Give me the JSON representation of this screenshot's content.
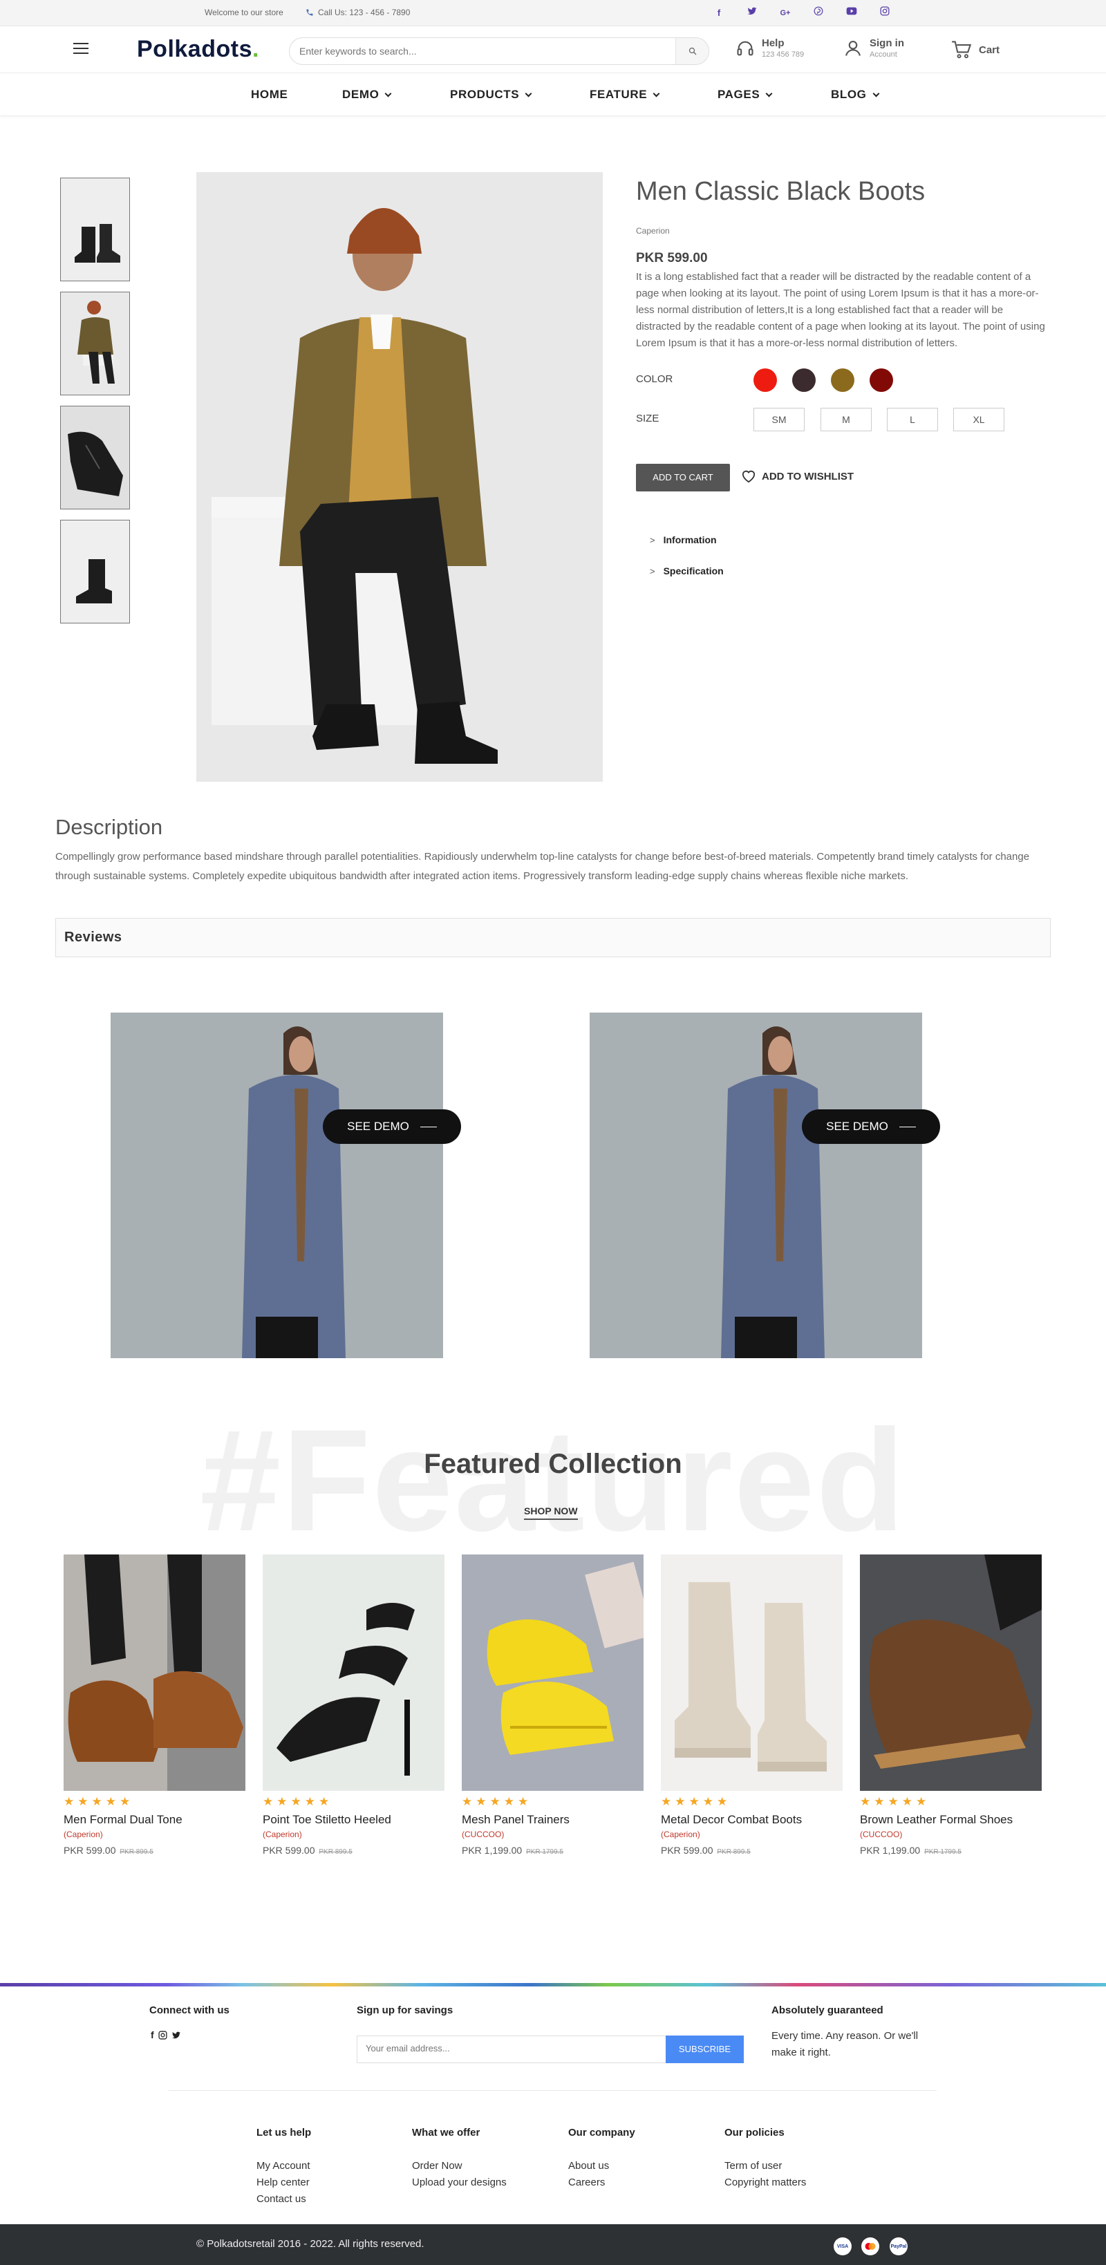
{
  "topbar": {
    "welcome": "Welcome to our store",
    "call": "Call Us: 123 - 456 - 7890",
    "socials": [
      "facebook-icon",
      "twitter-icon",
      "google-plus-icon",
      "pinterest-icon",
      "youtube-icon",
      "instagram-icon"
    ]
  },
  "header": {
    "logo": "Polkadots",
    "search_placeholder": "Enter keywords to search...",
    "help_title": "Help",
    "help_phone": "123 456 789",
    "signin_title": "Sign in",
    "signin_sub": "Account",
    "cart": "Cart"
  },
  "nav": {
    "home": "HOME",
    "demo": "DEMO",
    "products": "PRODUCTS",
    "feature": "FEATURE",
    "pages": "PAGES",
    "blog": "BLOG"
  },
  "product": {
    "title": "Men Classic Black Boots",
    "brand": "Caperion",
    "price": "PKR 599.00",
    "description": "It is a long established fact that a reader will be distracted by the readable content of a page when looking at its layout. The point of using Lorem Ipsum is that it has a more-or-less normal distribution of letters,It is a long established fact that a reader will be distracted by the readable content of a page when looking at its layout. The point of using Lorem Ipsum is that it has a more-or-less normal distribution of letters.",
    "color_label": "COLOR",
    "colors": [
      "#ee1c10",
      "#3c2b2e",
      "#8c6a1d",
      "#820a06"
    ],
    "size_label": "SIZE",
    "sizes": [
      "SM",
      "M",
      "L",
      "XL"
    ],
    "add_to_cart": "ADD TO CART",
    "add_to_wishlist": "ADD TO WISHLIST",
    "accordion": [
      "Information",
      "Specification"
    ]
  },
  "description": {
    "title": "Description",
    "text": "Compellingly grow performance based mindshare through parallel potentialities. Rapidiously underwhelm top-line catalysts for change before best-of-breed materials. Competently brand timely catalysts for change through sustainable systems. Completely expedite ubiquitous bandwidth after integrated action items. Progressively transform leading-edge supply chains whereas flexible niche markets."
  },
  "reviews": {
    "title": "Reviews"
  },
  "demo": {
    "button": "SEE DEMO"
  },
  "featured": {
    "background_text": "#Featured",
    "title": "Featured Collection",
    "shop_now": "SHOP NOW",
    "products": [
      {
        "name": "Men Formal Dual Tone",
        "brand": "(Caperion)",
        "price": "PKR 599.00",
        "old_price": "PKR 899.5",
        "rating": 5
      },
      {
        "name": "Point Toe Stiletto Heeled",
        "brand": "(Caperion)",
        "price": "PKR 599.00",
        "old_price": "PKR 899.5",
        "rating": 5
      },
      {
        "name": "Mesh Panel Trainers",
        "brand": "(CUCCOO)",
        "price": "PKR 1,199.00",
        "old_price": "PKR 1799.5",
        "rating": 5
      },
      {
        "name": "Metal Decor Combat Boots",
        "brand": "(Caperion)",
        "price": "PKR 599.00",
        "old_price": "PKR 899.5",
        "rating": 5
      },
      {
        "name": "Brown Leather Formal Shoes",
        "brand": "(CUCCOO)",
        "price": "PKR 1,199.00",
        "old_price": "PKR 1799.5",
        "rating": 5
      }
    ]
  },
  "footer": {
    "connect_title": "Connect with us",
    "signup_title": "Sign up for savings",
    "email_placeholder": "Your email address...",
    "subscribe": "SUBSCRIBE",
    "guarantee_title": "Absolutely guaranteed",
    "guarantee_text": "Every time. Any reason. Or we'll make it right.",
    "help_title": "Let us help",
    "help_links": [
      "My Account",
      "Help center",
      "Contact us"
    ],
    "offer_title": "What we offer",
    "offer_links": [
      "Order Now",
      "Upload your designs"
    ],
    "company_title": "Our company",
    "company_links": [
      "About us",
      "Careers"
    ],
    "policies_title": "Our policies",
    "policies_links": [
      "Term of user",
      "Copyright matters"
    ],
    "copyright": "© Polkadotsretail 2016 - 2022. All rights reserved.",
    "payments": [
      "visa-icon",
      "mastercard-icon",
      "paypal-icon"
    ]
  }
}
